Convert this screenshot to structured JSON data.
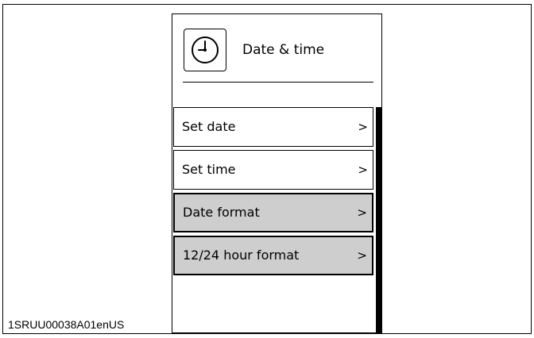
{
  "header": {
    "title": "Date & time",
    "icon": "clock-icon"
  },
  "menu": {
    "items": [
      {
        "label": "Set date",
        "chevron": ">",
        "highlighted": false
      },
      {
        "label": "Set time",
        "chevron": ">",
        "highlighted": false
      },
      {
        "label": "Date format",
        "chevron": ">",
        "highlighted": true
      },
      {
        "label": "12/24 hour format",
        "chevron": ">",
        "highlighted": true
      }
    ]
  },
  "figure_id": "1SRUU00038A01enUS",
  "colors": {
    "highlight": "#cecece",
    "border": "#000000",
    "background": "#ffffff"
  }
}
